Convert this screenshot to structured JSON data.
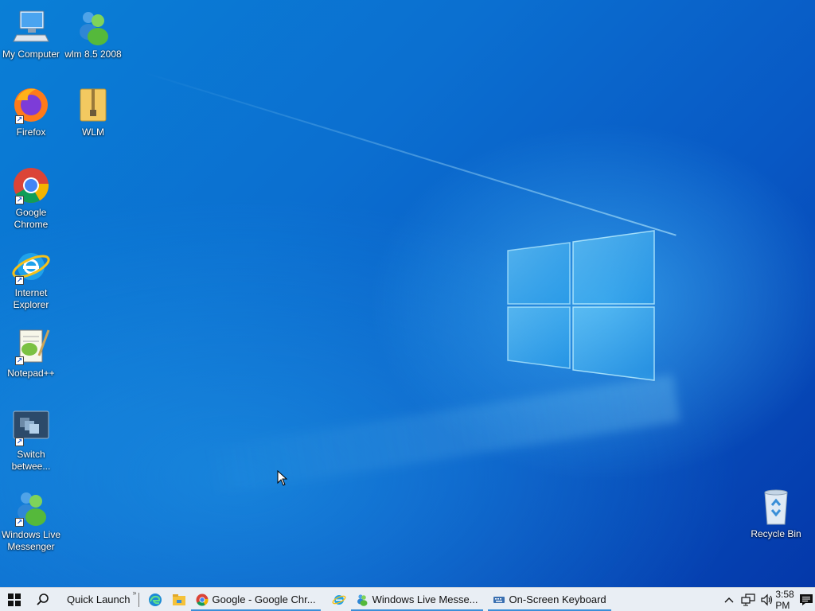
{
  "desktop": {
    "icons": [
      {
        "label": "My Computer"
      },
      {
        "label": "wlm 8.5 2008"
      },
      {
        "label": "Firefox"
      },
      {
        "label": "WLM"
      },
      {
        "label": "Google Chrome"
      },
      {
        "label": "Internet Explorer"
      },
      {
        "label": "Notepad++"
      },
      {
        "label": "Switch betwee..."
      },
      {
        "label": "Windows Live Messenger"
      },
      {
        "label": "Recycle Bin"
      }
    ]
  },
  "taskbar": {
    "quick_launch_label": "Quick Launch",
    "quick_launch_chevron": "»",
    "tasks": [
      {
        "label": "Google - Google Chr...",
        "icon": "chrome-icon"
      },
      {
        "label": "Windows Live Messe...",
        "icon": "messenger-icon"
      },
      {
        "label": "On-Screen Keyboard",
        "icon": "keyboard-icon"
      }
    ],
    "quick_launch_icons": [
      "edge-icon",
      "file-explorer-icon",
      "internet-explorer-icon"
    ],
    "tray_icons": [
      "show-hidden-icons",
      "network-icon",
      "volume-icon"
    ],
    "clock": "3:58 PM"
  },
  "colors": {
    "taskbar_bg": "#e9eef4",
    "active_underline": "#3b8fd9",
    "desktop_blue": "#0b6fd0"
  }
}
